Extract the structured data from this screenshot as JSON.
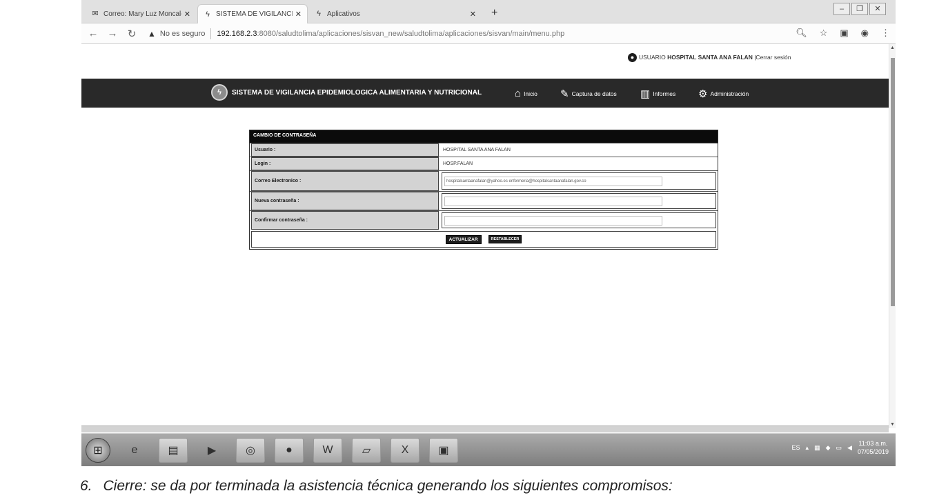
{
  "browser": {
    "tabs": [
      {
        "title": "Correo: Mary Luz Moncaleano H",
        "icon": "mail-icon",
        "active": false
      },
      {
        "title": "SISTEMA DE VIGILANCIA EPIDE",
        "icon": "app-icon",
        "active": true
      },
      {
        "title": "Aplicativos",
        "icon": "app-icon",
        "active": false
      }
    ],
    "new_tab_label": "+",
    "security_label": "No es seguro",
    "url_host": "192.168.2.3",
    "url_rest": ":8080/saludtolima/aplicaciones/sisvan_new/saludtolima/aplicaciones/sisvan/main/menu.php"
  },
  "header": {
    "user_prefix": "USUARIO",
    "user_name": "HOSPITAL SANTA ANA FALAN",
    "logout_label": "|Cerrar sesión"
  },
  "navbar": {
    "brand": "SISTEMA DE VIGILANCIA EPIDEMIOLOGICA ALIMENTARIA Y NUTRICIONAL",
    "links": {
      "inicio": "Inicio",
      "captura": "Captura de datos",
      "informes": "Informes",
      "administracion": "Administración"
    }
  },
  "form": {
    "title": "CAMBIO DE CONTRASEÑA",
    "usuario_label": "Usuario :",
    "usuario_value": "HOSPITAL SANTA ANA FALAN",
    "login_label": "Login :",
    "login_value": "HOSP.FALAN",
    "correo_label": "Correo Electronico :",
    "correo_value": "hospitalsantaanafalan@yahoo.es enfermeria@hospitalsantaanafalan.gov.co",
    "nueva_label": "Nueva contraseña :",
    "nueva_value": "",
    "confirmar_label": "Confirmar contraseña :",
    "confirmar_value": "",
    "actualizar_label": "ACTUALIZAR",
    "restablecer_label": "RESTABLECER"
  },
  "taskbar": {
    "language": "ES",
    "time": "11:03 a.m.",
    "date": "07/05/2019"
  },
  "caption": {
    "number": "6.",
    "text": "Cierre:  se da por terminada la asistencia técnica generando los siguientes compromisos:"
  }
}
